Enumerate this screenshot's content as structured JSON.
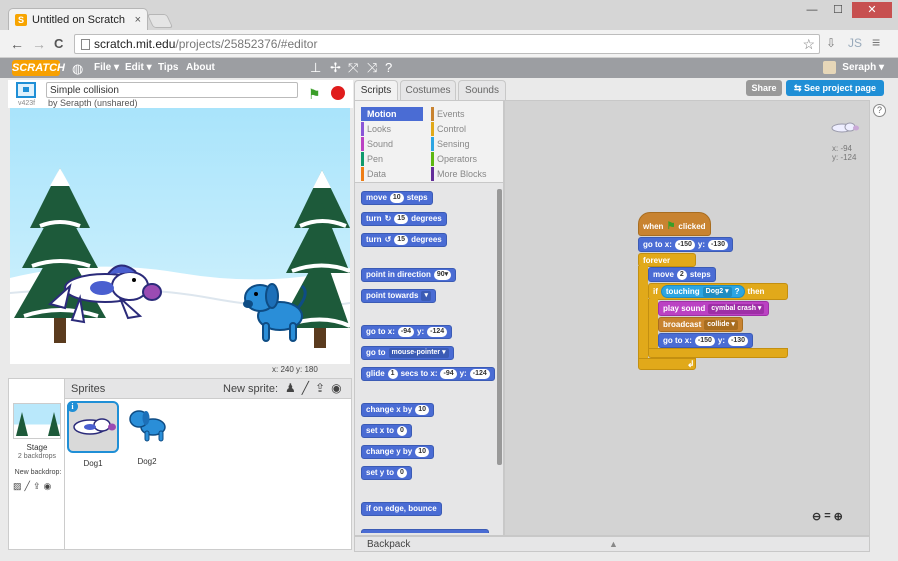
{
  "browser": {
    "tab_title": "Untitled on Scratch",
    "tab_close": "×",
    "win_min": "—",
    "win_max": "☐",
    "win_close": "✕",
    "back": "←",
    "forward": "→",
    "reload": "C",
    "url_host": "scratch.mit.edu",
    "url_path": "/projects/25852376/#editor",
    "star": "☆",
    "ext_label": "JS",
    "menu_icon": "≡"
  },
  "menubar": {
    "logo": "SCRATCH",
    "items": [
      "File ▾",
      "Edit ▾",
      "Tips",
      "About"
    ],
    "user": "Seraph ▾"
  },
  "stage_header": {
    "version": "v423f",
    "title_value": "Simple collision",
    "byline": "by Serapth (unshared)"
  },
  "stage": {
    "coords": "x: 240  y: 180"
  },
  "sprites_pane": {
    "header": "Sprites",
    "new_sprite": "New sprite:",
    "stage_name": "Stage",
    "stage_sub": "2 backdrops",
    "new_backdrop": "New backdrop:",
    "sprites": [
      {
        "name": "Dog1",
        "selected": true
      },
      {
        "name": "Dog2",
        "selected": false
      }
    ],
    "info": "i"
  },
  "tabs": [
    "Scripts",
    "Costumes",
    "Sounds"
  ],
  "header_buttons": {
    "share": "Share",
    "see_page": "See project page"
  },
  "categories": [
    {
      "name": "Motion",
      "color": "#4a6cd4"
    },
    {
      "name": "Looks",
      "color": "#8a55d7"
    },
    {
      "name": "Sound",
      "color": "#bb42c3"
    },
    {
      "name": "Pen",
      "color": "#0e9a6c"
    },
    {
      "name": "Data",
      "color": "#ee7d16"
    },
    {
      "name": "Events",
      "color": "#c88330"
    },
    {
      "name": "Control",
      "color": "#e1a91a"
    },
    {
      "name": "Sensing",
      "color": "#2ca5e2"
    },
    {
      "name": "Operators",
      "color": "#5cb712"
    },
    {
      "name": "More Blocks",
      "color": "#632d99"
    }
  ],
  "palette_blocks": {
    "move": [
      "move",
      "10",
      "steps"
    ],
    "turn_cw": [
      "turn",
      "↻",
      "15",
      "degrees"
    ],
    "turn_ccw": [
      "turn",
      "↺",
      "15",
      "degrees"
    ],
    "point_dir": [
      "point in direction",
      "90▾"
    ],
    "point_towards": [
      "point towards",
      "▾"
    ],
    "goto_xy": [
      "go to x:",
      "-94",
      "y:",
      "-124"
    ],
    "goto_target": [
      "go to",
      "mouse-pointer ▾"
    ],
    "glide": [
      "glide",
      "1",
      "secs to x:",
      "-94",
      "y:",
      "-124"
    ],
    "change_x": [
      "change x by",
      "10"
    ],
    "set_x": [
      "set x to",
      "0"
    ],
    "change_y": [
      "change y by",
      "10"
    ],
    "set_y": [
      "set y to",
      "0"
    ],
    "bounce": [
      "if on edge, bounce"
    ]
  },
  "script": {
    "when_clicked": [
      "when",
      "clicked"
    ],
    "goto_start": [
      "go to x:",
      "-150",
      "y:",
      "-130"
    ],
    "forever": "forever",
    "move": [
      "move",
      "2",
      "steps"
    ],
    "if_touching": [
      "if",
      "touching",
      "Dog2 ▾",
      "?",
      "then"
    ],
    "play_sound": [
      "play sound",
      "cymbal crash ▾"
    ],
    "broadcast": [
      "broadcast",
      "collide ▾"
    ],
    "goto_reset": [
      "go to x:",
      "-150",
      "y:",
      "-130"
    ],
    "loop_arrow": "↲"
  },
  "script_area": {
    "x": "x: -94",
    "y": "y: -124",
    "help": "?",
    "zoom_out": "⊖",
    "zoom_reset": "=",
    "zoom_in": "⊕"
  },
  "backpack": {
    "label": "Backpack",
    "arrow": "▲"
  }
}
